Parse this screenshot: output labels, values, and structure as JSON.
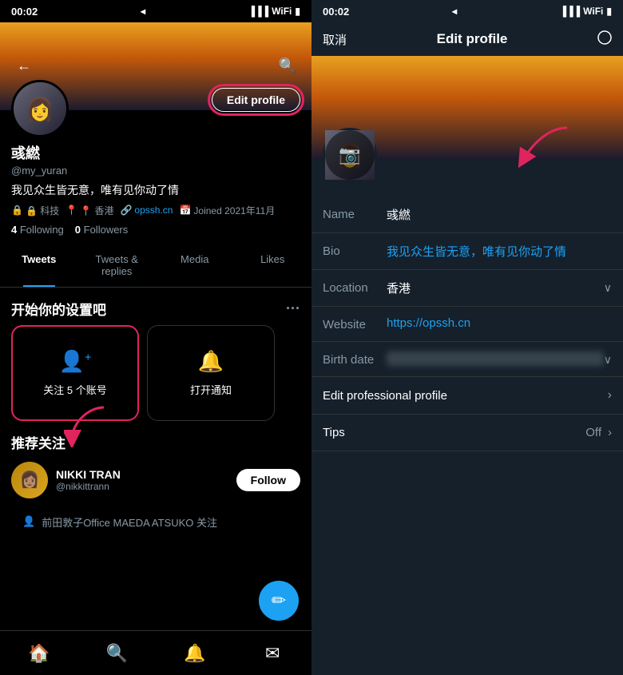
{
  "left": {
    "status": {
      "time": "00:02",
      "location_icon": "◂",
      "wifi": "WiFi",
      "battery": "🔋"
    },
    "nav": {
      "back_label": "←",
      "search_label": "🔍"
    },
    "cover_alt": "Sunset mountains cover photo",
    "profile": {
      "display_name": "彧繎",
      "username": "@my_yuran",
      "bio": "我见众生皆无意，唯有见你动了情",
      "meta_tech": "🔒 科技",
      "meta_location": "📍 香港",
      "meta_website": "opssh.cn",
      "meta_joined": "Joined 2021年11月",
      "following_count": "4",
      "following_label": "Following",
      "followers_count": "0",
      "followers_label": "Followers",
      "edit_profile_label": "Edit profile"
    },
    "tabs": [
      {
        "label": "Tweets",
        "active": true
      },
      {
        "label": "Tweets & replies",
        "active": false
      },
      {
        "label": "Media",
        "active": false
      },
      {
        "label": "Likes",
        "active": false
      }
    ],
    "setup_section": {
      "title": "开始你的设置吧",
      "dots": "···",
      "cards": [
        {
          "icon": "👤+",
          "label": "关注 5 个账号",
          "highlighted": true
        },
        {
          "icon": "🔔",
          "label": "打开通知",
          "highlighted": false
        }
      ]
    },
    "recommend": {
      "title": "推荐关注",
      "items": [
        {
          "name": "NIKKI TRAN",
          "handle": "@nikkittrann",
          "follow_label": "Follow"
        }
      ],
      "sub_item": "前田敦子Office MAEDA ATSUKO 关注"
    },
    "bottom_nav": {
      "home": "🏠",
      "search": "🔍",
      "notifications": "🔔",
      "messages": "✉"
    },
    "compose_icon": "✏"
  },
  "right": {
    "status": {
      "time": "00:02",
      "wifi": "WiFi",
      "battery": "🔋"
    },
    "header": {
      "cancel_label": "取消",
      "title": "Edit profile",
      "save_label": ""
    },
    "cover_alt": "Sunset mountains cover photo",
    "avatar_camera_icon": "📷",
    "arrow_label": "→",
    "fields": [
      {
        "label": "Name",
        "value": "彧繎",
        "type": "name",
        "chevron": false,
        "link": false
      },
      {
        "label": "Bio",
        "value": "我见众生皆无意，唯有见你动了情",
        "type": "bio",
        "chevron": false,
        "link": true
      },
      {
        "label": "Location",
        "value": "香港",
        "type": "location",
        "chevron": true,
        "link": false
      },
      {
        "label": "Website",
        "value": "https://opssh.cn",
        "type": "website",
        "chevron": false,
        "link": true
      },
      {
        "label": "Birth date",
        "value": "██████████",
        "type": "birthdate",
        "chevron": true,
        "link": false,
        "blurred": true
      }
    ],
    "professional_label": "Edit professional profile",
    "tips_label": "Tips",
    "tips_value": "Off"
  }
}
